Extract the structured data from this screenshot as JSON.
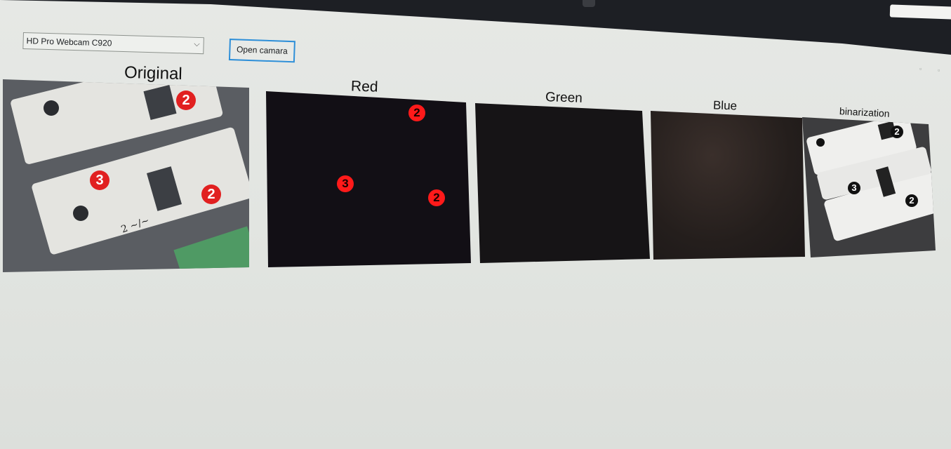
{
  "camera_select": {
    "value": "HD Pro Webcam C920",
    "chevron": "chevron-down-icon"
  },
  "open_button": {
    "label": "Open camara",
    "accent": "#2e8fd8"
  },
  "panels": {
    "original": {
      "label": "Original"
    },
    "red": {
      "label": "Red",
      "markers": [
        "2",
        "3",
        "2"
      ]
    },
    "green": {
      "label": "Green"
    },
    "blue": {
      "label": "Blue"
    },
    "binarization": {
      "label": "binarization"
    }
  },
  "original_markers": [
    "2",
    "3",
    "2"
  ],
  "handwriting": "2 ~/~",
  "binarization_markers": [
    "2",
    "3",
    "2"
  ],
  "colors": {
    "marker_red": "#e12020",
    "window_bg": "#e2e5e1",
    "button_border": "#2e8fd8"
  }
}
